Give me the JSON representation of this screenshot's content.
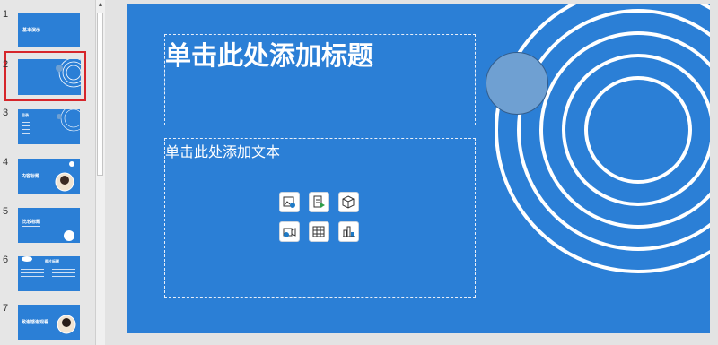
{
  "thumbnails": [
    {
      "number": "1",
      "title": "基本演示",
      "theme_color": "#2b7fd6"
    },
    {
      "number": "2",
      "title": "",
      "theme_color": "#2b7fd6"
    },
    {
      "number": "3",
      "title": "目录",
      "theme_color": "#2b7fd6"
    },
    {
      "number": "4",
      "title": "内容标题",
      "theme_color": "#2b7fd6"
    },
    {
      "number": "5",
      "title": "比较标题",
      "theme_color": "#2b7fd6"
    },
    {
      "number": "6",
      "title": "图片标题",
      "theme_color": "#2b7fd6"
    },
    {
      "number": "7",
      "title": "致谢感谢观看",
      "theme_color": "#2b7fd6"
    }
  ],
  "selected_thumbnail": "2",
  "slide": {
    "title_placeholder": "单击此处添加标题",
    "body_placeholder": "单击此处添加文本",
    "background": "#2b7fd6",
    "insert_icons": [
      "insert-picture-icon",
      "insert-document-icon",
      "insert-3d-model-icon",
      "insert-video-icon",
      "insert-table-icon",
      "insert-chart-icon"
    ]
  },
  "colors": {
    "slide_blue": "#2b7fd6",
    "selection_red": "#d6262b",
    "circle_fill": "#6fa0d2"
  }
}
